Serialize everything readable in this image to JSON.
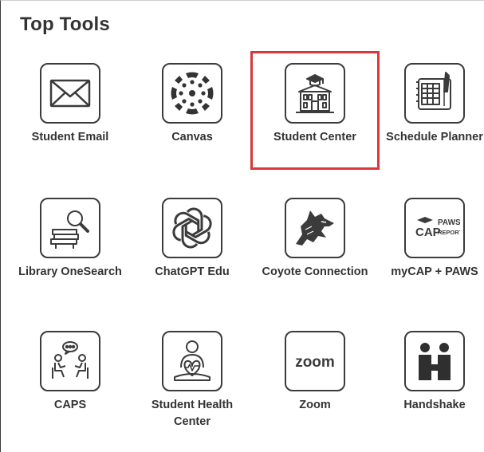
{
  "section": {
    "title": "Top Tools"
  },
  "tools": [
    {
      "label": "Student Email",
      "icon": "envelope-icon"
    },
    {
      "label": "Canvas",
      "icon": "canvas-logo-icon"
    },
    {
      "label": "Student Center",
      "icon": "school-building-icon",
      "selected": true
    },
    {
      "label": "Schedule Planner",
      "icon": "schedule-planner-icon"
    },
    {
      "label": "Library OneSearch",
      "icon": "library-search-icon"
    },
    {
      "label": "ChatGPT Edu",
      "icon": "chatgpt-logo-icon"
    },
    {
      "label": "Coyote Connection",
      "icon": "coyote-icon"
    },
    {
      "label": "myCAP + PAWS",
      "icon": "mycap-paws-icon",
      "icon_text": {
        "cap": "CAP",
        "paws": "PAWS",
        "report": "REPORT"
      }
    },
    {
      "label": "CAPS",
      "icon": "counseling-icon"
    },
    {
      "label": "Student Health Center",
      "icon": "health-center-icon"
    },
    {
      "label": "Zoom",
      "icon": "zoom-logo-icon",
      "icon_text": "zoom"
    },
    {
      "label": "Handshake",
      "icon": "handshake-logo-icon"
    }
  ],
  "colors": {
    "highlight": "#d9373b",
    "icon_stroke": "#3b3b3b",
    "text": "#333333"
  }
}
